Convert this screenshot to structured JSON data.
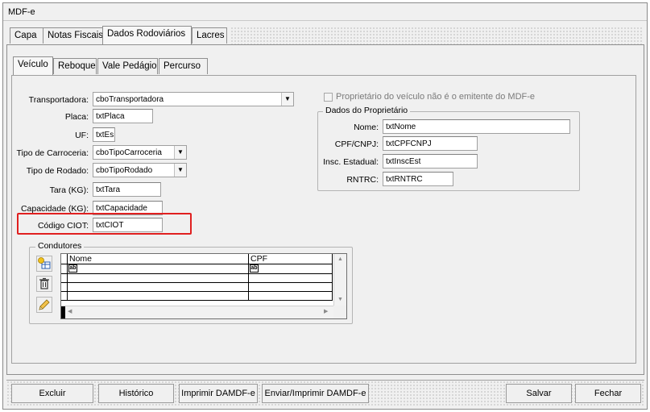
{
  "window": {
    "title": "MDF-e"
  },
  "main_tabs": [
    {
      "label": "Capa",
      "accel": "C"
    },
    {
      "label": "Notas Fiscais",
      "accel": "N"
    },
    {
      "label": "Dados Rodoviários",
      "accel": ""
    },
    {
      "label": "Lacres",
      "accel": "L"
    }
  ],
  "sub_tabs": [
    {
      "label": "Veículo"
    },
    {
      "label": "Reboque"
    },
    {
      "label": "Vale Pedágio"
    },
    {
      "label": "Percurso"
    }
  ],
  "form": {
    "transportadora": {
      "label": "Transportadora:",
      "value": "cboTransportadora"
    },
    "placa": {
      "label": "Placa:",
      "value": "txtPlaca"
    },
    "uf": {
      "label": "UF:",
      "value": "txtEs"
    },
    "tipo_carroceria": {
      "label": "Tipo de Carroceria:",
      "value": "cboTipoCarroceria"
    },
    "tipo_rodado": {
      "label": "Tipo de Rodado:",
      "value": "cboTipoRodado"
    },
    "tara": {
      "label": "Tara (KG):",
      "value": "txtTara"
    },
    "capacidade": {
      "label": "Capacidade (KG):",
      "value": "txtCapacidade"
    },
    "codigo_ciot": {
      "label": "Código CIOT:",
      "value": "txtCIOT"
    }
  },
  "proprietario": {
    "checkbox_label": "Proprietário do veículo não é o emitente do MDF-e",
    "checked": false,
    "group_title": "Dados do Proprietário",
    "nome": {
      "label": "Nome:",
      "value": "txtNome"
    },
    "cpf_cnpj": {
      "label": "CPF/CNPJ:",
      "value": "txtCPFCNPJ"
    },
    "insc_estadual": {
      "label": "Insc. Estadual:",
      "value": "txtInscEst"
    },
    "rntrc": {
      "label": "RNTRC:",
      "value": "txtRNTRC"
    }
  },
  "condutores": {
    "group_title": "Condutores",
    "columns": [
      "Nome",
      "CPF"
    ],
    "cell_placeholder": "ab"
  },
  "buttons": {
    "excluir": "Excluir",
    "historico": "Histórico",
    "imprimir": "Imprimir DAMDF-e",
    "enviar_imprimir": "Enviar/Imprimir DAMDF-e",
    "salvar": "Salvar",
    "fechar": "Fechar"
  },
  "colors": {
    "highlight": "#e02020"
  }
}
